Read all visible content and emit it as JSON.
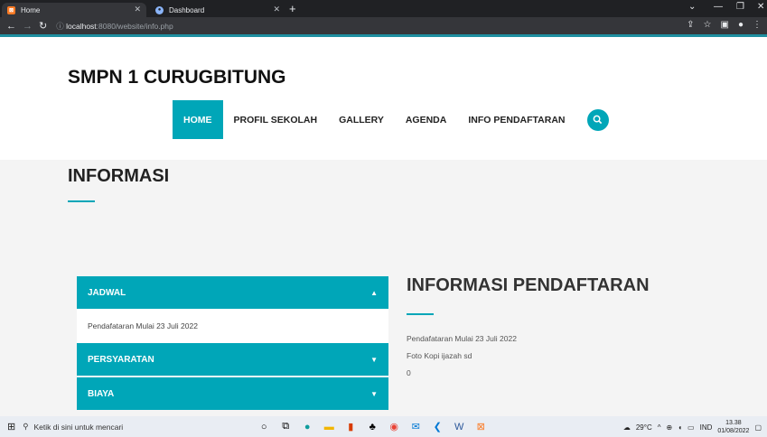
{
  "browser": {
    "tabs": [
      {
        "label": "Home",
        "icon": "xampp-icon"
      },
      {
        "label": "Dashboard",
        "icon": "globe-icon"
      }
    ],
    "new_tab": "+",
    "url_host": "localhost",
    "url_rest": ":8080/website/info.php"
  },
  "site": {
    "brand": "SMPN 1 CURUGBITUNG",
    "menu": [
      "HOME",
      "PROFIL SEKOLAH",
      "GALLERY",
      "AGENDA",
      "INFO PENDAFTARAN"
    ],
    "active_menu": "HOME",
    "page_title": "INFORMASI",
    "accordion": [
      {
        "title": "JADWAL",
        "open": true,
        "body": "Pendafataran Mulai 23 Juli 2022"
      },
      {
        "title": "PERSYARATAN",
        "open": false
      },
      {
        "title": "BIAYA",
        "open": false
      }
    ],
    "right_title": "INFORMASI PENDAFTARAN",
    "right_lines": [
      "Pendafataran Mulai 23 Juli 2022",
      "Foto Kopi ijazah sd",
      "0"
    ],
    "accent": "#00a6b8"
  },
  "taskbar": {
    "search_placeholder": "Ketik di sini untuk mencari",
    "weather": "29°C",
    "lang": "IND",
    "time": "13.38",
    "date": "01/08/2022"
  }
}
